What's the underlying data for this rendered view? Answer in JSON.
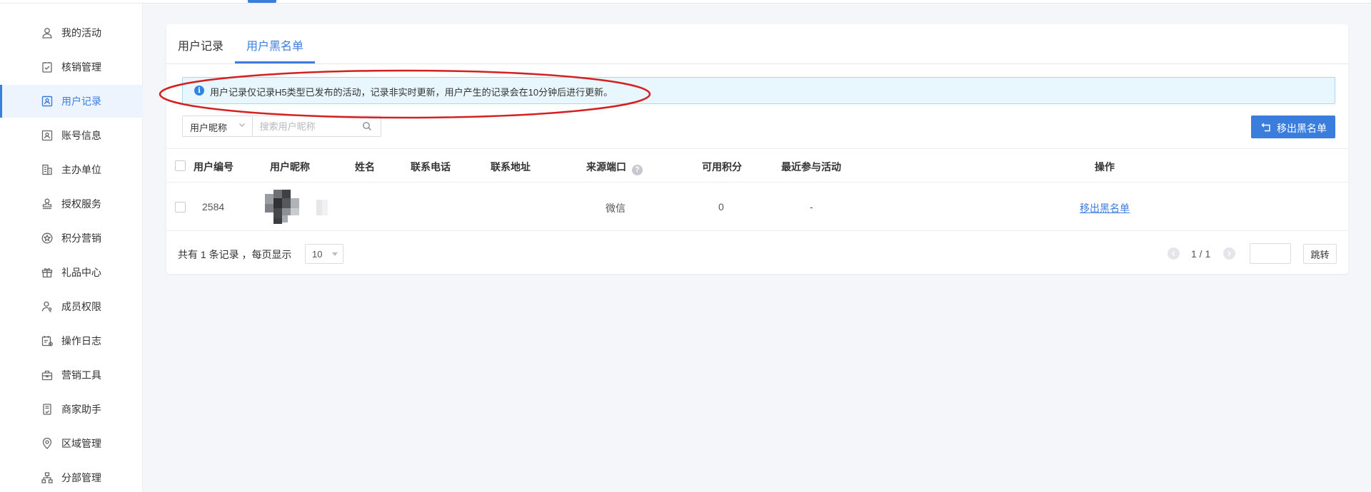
{
  "sidebar": {
    "items": [
      {
        "label": "我的活动",
        "icon": "person-icon"
      },
      {
        "label": "核销管理",
        "icon": "clipboard-check-icon"
      },
      {
        "label": "用户记录",
        "icon": "user-card-icon",
        "active": true
      },
      {
        "label": "账号信息",
        "icon": "account-icon"
      },
      {
        "label": "主办单位",
        "icon": "building-icon"
      },
      {
        "label": "授权服务",
        "icon": "stamp-icon"
      },
      {
        "label": "积分营销",
        "icon": "star-circle-icon"
      },
      {
        "label": "礼品中心",
        "icon": "gift-icon"
      },
      {
        "label": "成员权限",
        "icon": "user-key-icon"
      },
      {
        "label": "操作日志",
        "icon": "calendar-log-icon"
      },
      {
        "label": "营销工具",
        "icon": "toolbox-icon"
      },
      {
        "label": "商家助手",
        "icon": "phone-doc-icon"
      },
      {
        "label": "区域管理",
        "icon": "location-icon"
      },
      {
        "label": "分部管理",
        "icon": "org-chart-icon"
      }
    ]
  },
  "tabs": [
    {
      "label": "用户记录"
    },
    {
      "label": "用户黑名单",
      "active": true
    }
  ],
  "notice": {
    "text": "用户记录仅记录H5类型已发布的活动，记录非实时更新，用户产生的记录会在10分钟后进行更新。"
  },
  "filter": {
    "field": "用户昵称",
    "placeholder": "搜索用户昵称"
  },
  "actions": {
    "remove_blacklist": "移出黑名单"
  },
  "table": {
    "headers": {
      "id": "用户编号",
      "nickname": "用户昵称",
      "name": "姓名",
      "phone": "联系电话",
      "address": "联系地址",
      "source": "来源端口",
      "points": "可用积分",
      "recent": "最近参与活动",
      "ops": "操作"
    },
    "rows": [
      {
        "id": "2584",
        "name": "",
        "phone": "",
        "address": "",
        "source": "微信",
        "points": "0",
        "recent": "-",
        "op": "移出黑名单"
      }
    ]
  },
  "pagination": {
    "total_text": "共有 1 条记录 ，每页显示",
    "page_size": "10",
    "page_indicator": "1 / 1",
    "jump_label": "跳转"
  },
  "colors": {
    "accent": "#3b7ddd",
    "notice_bg": "#e8f7fd",
    "annotation": "#d42020"
  }
}
